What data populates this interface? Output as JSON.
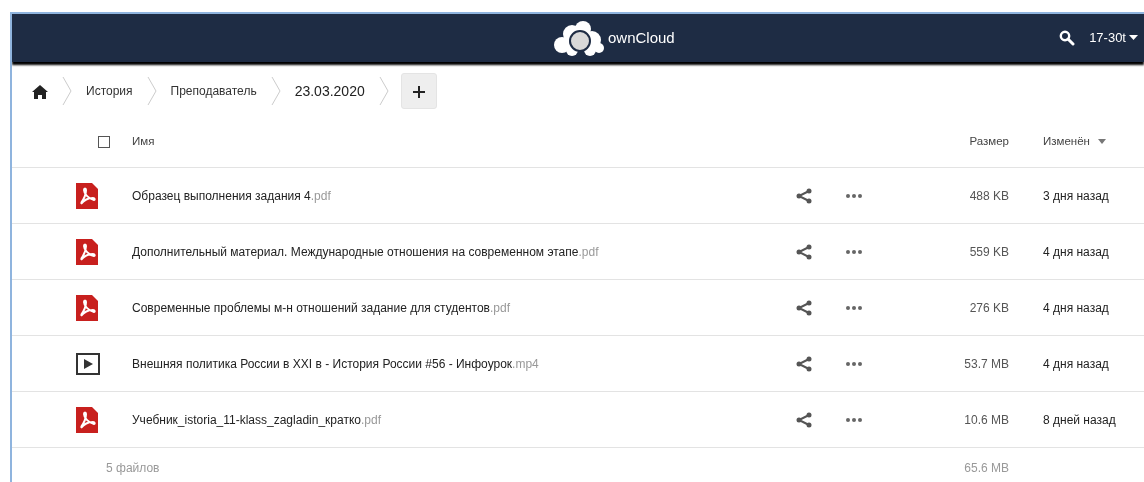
{
  "header": {
    "logo_text": "ownCloud",
    "user": "17-30t"
  },
  "breadcrumb": [
    {
      "label": "История",
      "current": false
    },
    {
      "label": "Преподаватель",
      "current": false
    },
    {
      "label": "23.03.2020",
      "current": true
    }
  ],
  "columns": {
    "select_all_checked": false,
    "name": "Имя",
    "size": "Размер",
    "modified": "Изменён"
  },
  "files": [
    {
      "kind": "pdf",
      "name": "Образец выполнения задания 4",
      "ext": ".pdf",
      "size": "488 KB",
      "modified": "3 дня назад"
    },
    {
      "kind": "pdf",
      "name": "Дополнительный материал. Международные отношения на современном этапе",
      "ext": ".pdf",
      "size": "559 KB",
      "modified": "4 дня назад"
    },
    {
      "kind": "pdf",
      "name": "Современные проблемы м-н отношений задание для студентов",
      "ext": ".pdf",
      "size": "276 KB",
      "modified": "4 дня назад"
    },
    {
      "kind": "video",
      "name": "Внешняя политика России в XXI в - История России #56 - Инфоурок",
      "ext": ".mp4",
      "size": "53.7 MB",
      "modified": "4 дня назад"
    },
    {
      "kind": "pdf",
      "name": "Учебник_istoria_11-klass_zagladin_кратко",
      "ext": ".pdf",
      "size": "10.6 MB",
      "modified": "8 дней назад"
    }
  ],
  "footer": {
    "summary": "5 файлов",
    "total": "65.6 MB"
  }
}
